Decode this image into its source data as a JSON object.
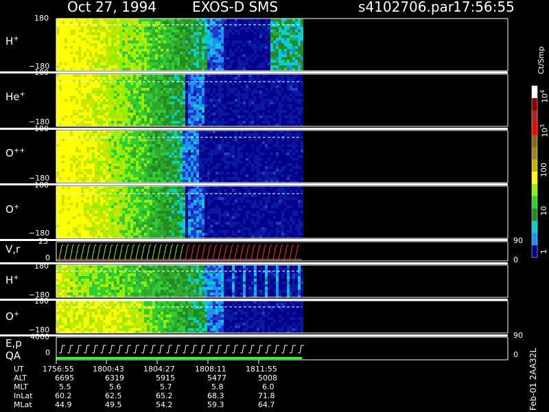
{
  "header": {
    "date": "Oct 27, 1994",
    "instrument": "EXOS-D SMS",
    "file": "s4102706.par",
    "time": "17:56:55"
  },
  "panels": [
    {
      "label": "H",
      "sup": "+",
      "top_tick": "180",
      "bottom_tick": "−180"
    },
    {
      "label": "He",
      "sup": "+",
      "top_tick": "180",
      "bottom_tick": "−180"
    },
    {
      "label": "O",
      "sup": "++",
      "top_tick": "180",
      "bottom_tick": "−180"
    },
    {
      "label": "O",
      "sup": "+",
      "top_tick": "180",
      "bottom_tick": "−180"
    },
    {
      "label": "V,r",
      "sup": "",
      "top_tick": "25",
      "bottom_tick": "0",
      "right_top": "90",
      "right_bottom": "0"
    },
    {
      "label": "H",
      "sup": "+",
      "top_tick": "180",
      "bottom_tick": "−180"
    },
    {
      "label": "O",
      "sup": "+",
      "top_tick": "180",
      "bottom_tick": "−180"
    },
    {
      "label": "E,p",
      "label2": "QA",
      "sup": "",
      "top_tick": "4000",
      "bottom_tick": "0",
      "right_top": "90",
      "right_bottom": "0"
    }
  ],
  "colorbar": {
    "unit": "Ct/Smp",
    "labels": [
      {
        "text": "10",
        "sup": "4"
      },
      {
        "text": "10",
        "sup": "3"
      },
      {
        "text": "100",
        "sup": ""
      },
      {
        "text": "10",
        "sup": ""
      },
      {
        "text": "1",
        "sup": ""
      }
    ],
    "colors": [
      "#ffffff",
      "#8b0000",
      "#b22222",
      "#ff0000",
      "#8b6914",
      "#9c8a1f",
      "#c8b400",
      "#ffff00",
      "#90ee00",
      "#32cd32",
      "#228b22",
      "#00ced1",
      "#1e90ff",
      "#00008b"
    ]
  },
  "footer": {
    "rows": [
      {
        "name": "UT",
        "values": [
          "1756:55",
          "1800:43",
          "1804:27",
          "1808:11",
          "1811:55"
        ]
      },
      {
        "name": "ALT",
        "values": [
          "6695",
          "6319",
          "5915",
          "5477",
          "5008"
        ]
      },
      {
        "name": "MLT",
        "values": [
          "5.5",
          "5.6",
          "5.7",
          "5.8",
          "6.0"
        ]
      },
      {
        "name": "InLat",
        "values": [
          "60.2",
          "62.5",
          "65.2",
          "68.3",
          "71.8"
        ]
      },
      {
        "name": "MLat",
        "values": [
          "44.9",
          "49.5",
          "54.2",
          "59.3",
          "64.7"
        ]
      }
    ],
    "side_label": "Feb-01 2AA32L"
  },
  "chart_data": {
    "type": "heatmap",
    "title": "Oct 27, 1994 EXOS-D SMS",
    "x_label": "UT",
    "x_ticks": [
      "1756:55",
      "1800:43",
      "1804:27",
      "1808:11",
      "1811:55"
    ],
    "colorbar_unit": "Ct/Smp",
    "colorbar_range": [
      1,
      10000
    ],
    "colorbar_scale": "log",
    "panels": [
      {
        "name": "H+",
        "ylim": [
          -180,
          180
        ]
      },
      {
        "name": "He+",
        "ylim": [
          -180,
          180
        ]
      },
      {
        "name": "O++",
        "ylim": [
          -180,
          180
        ]
      },
      {
        "name": "O+",
        "ylim": [
          -180,
          180
        ]
      },
      {
        "name": "V,r",
        "ylim": [
          0,
          25
        ],
        "right_ylim": [
          0,
          90
        ]
      },
      {
        "name": "H+",
        "ylim": [
          -180,
          180
        ]
      },
      {
        "name": "O+",
        "ylim": [
          -180,
          180
        ]
      },
      {
        "name": "E,p QA",
        "ylim": [
          0,
          4000
        ],
        "right_ylim": [
          0,
          90
        ]
      }
    ]
  }
}
